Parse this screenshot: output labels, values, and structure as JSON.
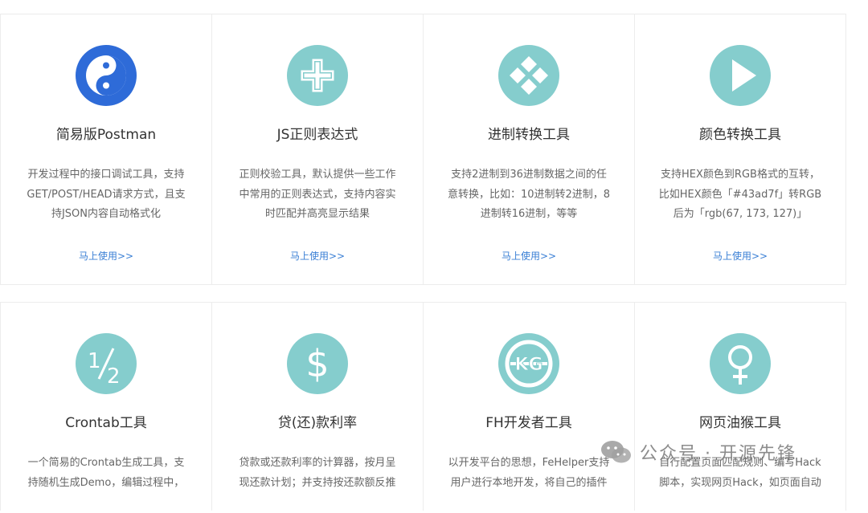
{
  "cards_row1": [
    {
      "title": "简易版Postman",
      "lines": [
        "开发过程中的接口调试工具，支持",
        "GET/POST/HEAD请求方式，且支",
        "持JSON内容自动格式化"
      ],
      "link": "马上使用>>",
      "icon": "yin-yang-icon"
    },
    {
      "title": "JS正则表达式",
      "lines": [
        "正则校验工具，默认提供一些工作",
        "中常用的正则表达式，支持内容实",
        "时匹配并高亮显示结果"
      ],
      "link": "马上使用>>",
      "icon": "plus-icon"
    },
    {
      "title": "进制转换工具",
      "lines": [
        "支持2进制到36进制数据之间的任",
        "意转换，比如：10进制转2进制，8",
        "进制转16进制，等等"
      ],
      "link": "马上使用>>",
      "icon": "diamonds-icon"
    },
    {
      "title": "颜色转换工具",
      "lines": [
        "支持HEX颜色到RGB格式的互转，",
        "比如HEX颜色「#43ad7f」转RGB",
        "后为「rgb(67, 173, 127)」"
      ],
      "link": "马上使用>>",
      "icon": "play-icon"
    }
  ],
  "cards_row2": [
    {
      "title": "Crontab工具",
      "lines": [
        "一个简易的Crontab生成工具，支",
        "持随机生成Demo，编辑过程中，"
      ],
      "icon": "one-half-icon"
    },
    {
      "title": "贷(还)款利率",
      "lines": [
        "贷款或还款利率的计算器，按月呈",
        "现还款计划；并支持按还款额反推"
      ],
      "icon": "dollar-icon"
    },
    {
      "title": "FH开发者工具",
      "lines": [
        "以开发平台的思想，FeHelper支持",
        "用户进行本地开发，将自己的插件"
      ],
      "icon": "kg-logo-icon"
    },
    {
      "title": "网页油猴工具",
      "lines": [
        "自行配置页面匹配规则、编写Hack",
        "脚本，实现网页Hack，如页面自动"
      ],
      "icon": "female-symbol-icon"
    }
  ],
  "watermark": {
    "text": "公众号 · 开源先锋",
    "icon": "wechat-icon"
  },
  "colors": {
    "teal": "#85cdcd",
    "blue": "#2e6bd8",
    "link": "#3a7fd5"
  }
}
